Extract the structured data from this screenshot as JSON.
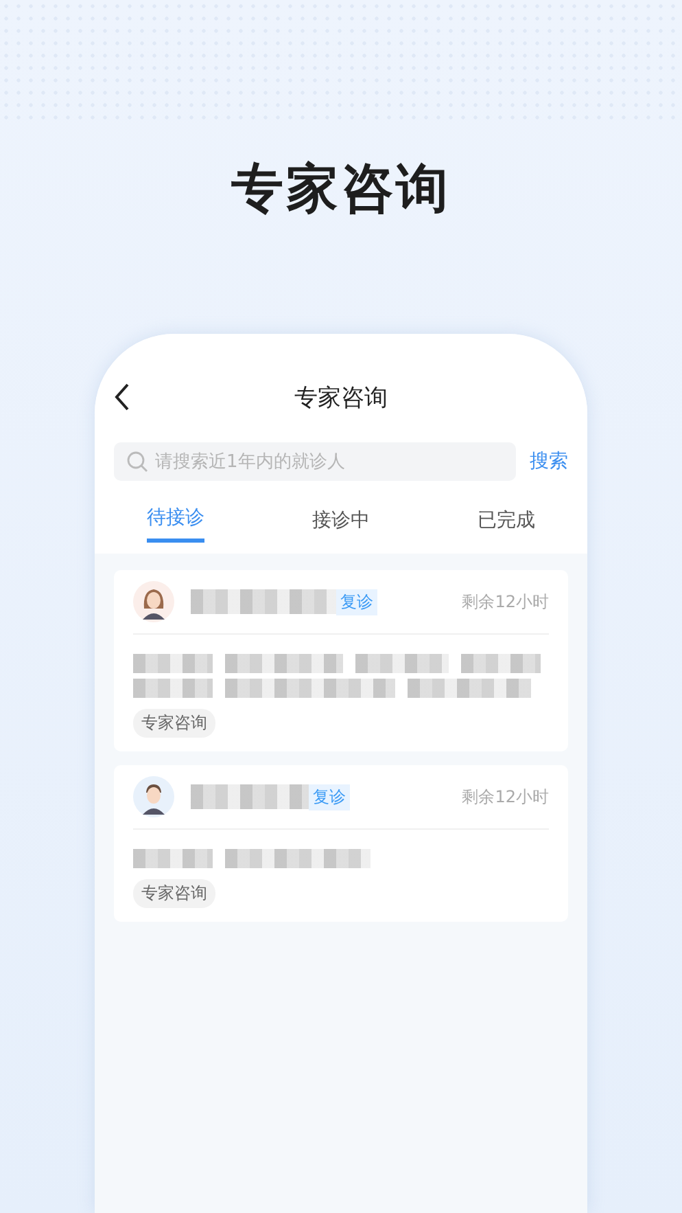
{
  "headline": "专家咨询",
  "screen": {
    "title": "专家咨询",
    "search": {
      "placeholder": "请搜索近1年内的就诊人",
      "button": "搜索"
    },
    "tabs": [
      {
        "label": "待接诊",
        "selected": true
      },
      {
        "label": "接诊中",
        "selected": false
      },
      {
        "label": "已完成",
        "selected": false
      }
    ],
    "cards": [
      {
        "kind": "female",
        "badge": "复诊",
        "time": "剩余12小时",
        "tag": "专家咨询"
      },
      {
        "kind": "male",
        "badge": "复诊",
        "time": "剩余12小时",
        "tag": "专家咨询"
      }
    ]
  }
}
